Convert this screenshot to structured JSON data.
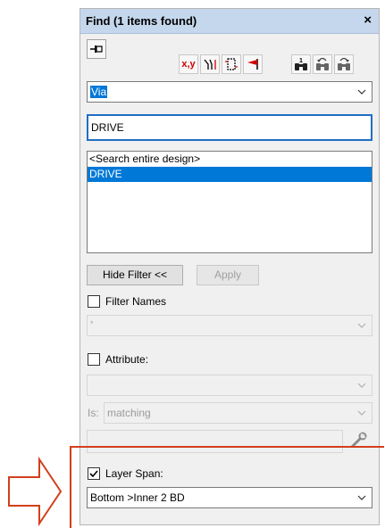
{
  "window": {
    "title": "Find (1 items found)",
    "close_label": "×"
  },
  "toolbar": {
    "pin_icon": "pin-icon",
    "xy_label": "x,y",
    "icons": [
      "xy-coordinate-icon",
      "route-icon",
      "component-outline-icon",
      "flag-icon",
      "find-icon",
      "find-previous-icon",
      "find-next-icon"
    ],
    "find_number": "1"
  },
  "type_combo": {
    "value": "Via"
  },
  "search_field": {
    "value": "DRIVE"
  },
  "results": {
    "items": [
      "<Search entire design>",
      "DRIVE"
    ],
    "selected_index": 1
  },
  "buttons": {
    "hide_filter": "Hide Filter <<",
    "apply": "Apply"
  },
  "filter_names": {
    "label": "Filter Names",
    "checked": false,
    "value": "*"
  },
  "attribute": {
    "label": "Attribute:",
    "checked": false,
    "value": ""
  },
  "is_row": {
    "label": "Is:",
    "value": "matching"
  },
  "layer_span": {
    "label": "Layer Span:",
    "checked": true,
    "value": "Bottom >Inner 2 BD"
  },
  "colors": {
    "selection": "#0078d7",
    "titlebar": "#c5d7ec",
    "callout": "#d23f1c"
  }
}
